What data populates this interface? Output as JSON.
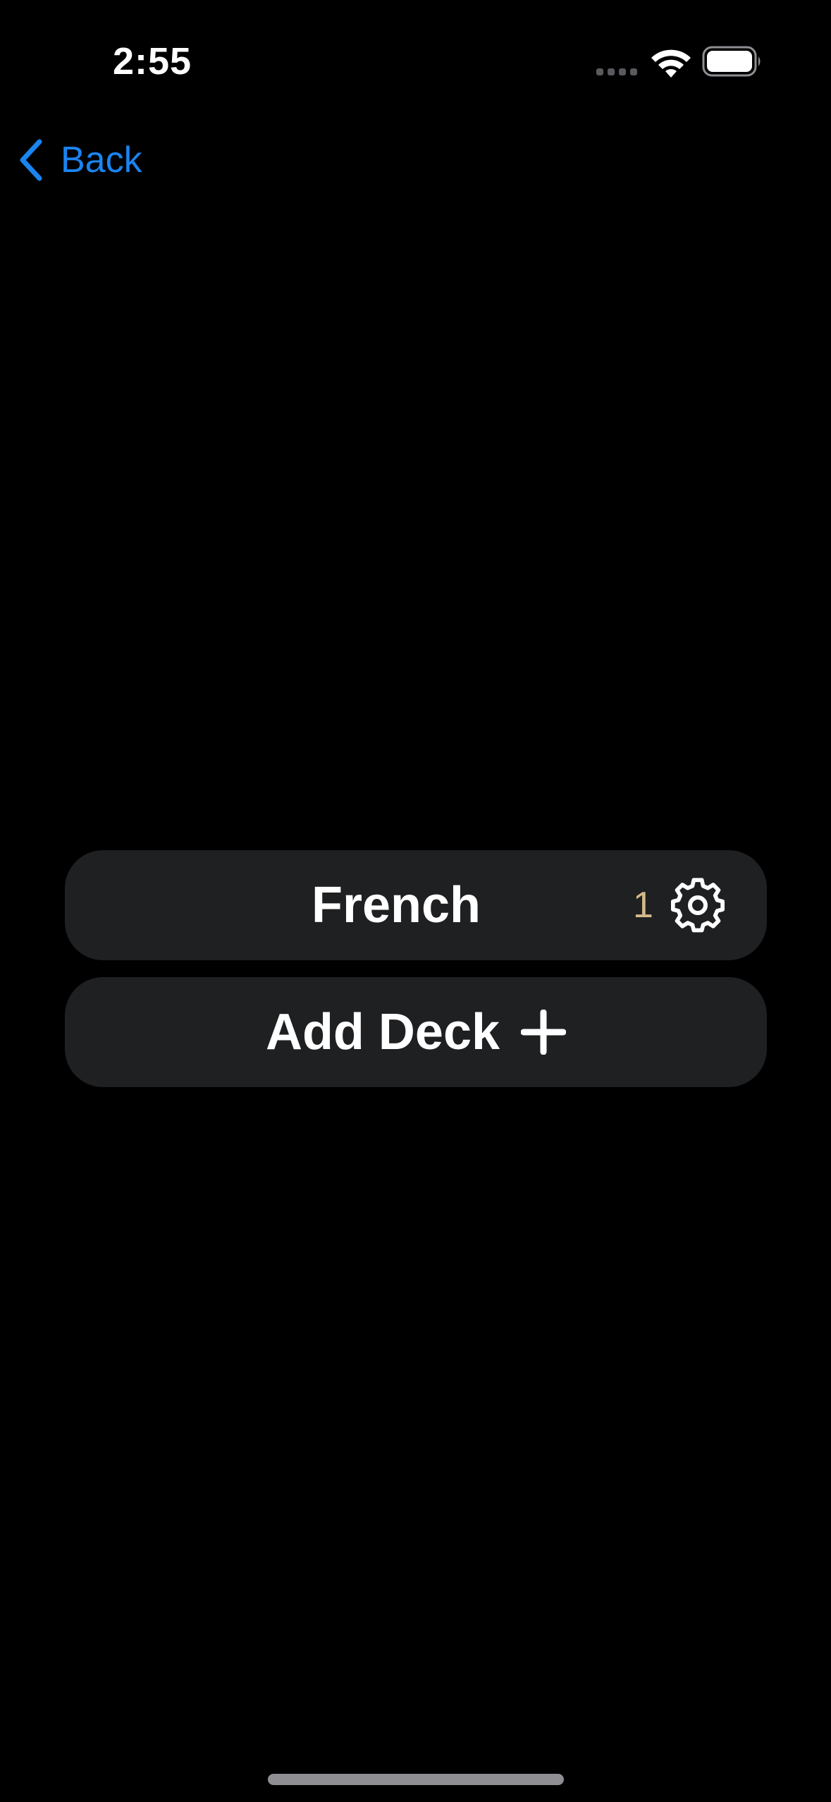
{
  "status_bar": {
    "time": "2:55",
    "wifi_icon": "wifi-icon",
    "battery_icon": "battery-full-icon",
    "signal_icon": "cellular-dots-icon"
  },
  "nav": {
    "back_label": "Back",
    "back_icon": "chevron-left-icon"
  },
  "decks": [
    {
      "name": "French",
      "count": "1",
      "settings_icon": "gear-icon"
    }
  ],
  "add_deck": {
    "label": "Add Deck",
    "icon": "plus-icon"
  },
  "colors": {
    "background": "#000000",
    "row_background": "#1f2022",
    "accent_blue": "#1a84f0",
    "count_color": "#d6b98a",
    "text": "#ffffff"
  }
}
